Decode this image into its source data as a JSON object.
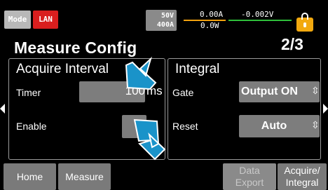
{
  "status_bar": {
    "mode_label": "Mode",
    "lan_label": "LAN",
    "voltage_range": "50V",
    "current_range": "400A",
    "current_reading": "0.00A",
    "voltage_reading": "-0.002V",
    "power_reading": "0.0W",
    "colors": {
      "current_underline": "#f2a20f",
      "voltage_underline": "#2fbf3a"
    }
  },
  "header": {
    "title": "Measure Config",
    "page_indicator": "2/3"
  },
  "acquire_panel": {
    "title": "Acquire Interval",
    "timer_label": "Timer",
    "timer_value": "100",
    "timer_unit": "ms",
    "enable_label": "Enable"
  },
  "integral_panel": {
    "title": "Integral",
    "gate_label": "Gate",
    "gate_value": "Output ON",
    "reset_label": "Reset",
    "reset_value": "Auto"
  },
  "bottom_bar": {
    "home": "Home",
    "measure": "Measure",
    "data_export_line1": "Data",
    "data_export_line2": "Export",
    "acquire_integral_line1": "Acquire/",
    "acquire_integral_line2": "Integral"
  },
  "colors": {
    "lock": "#f2a90f",
    "pointer_arrow": "#1a93c9",
    "lan": "#d91e1e"
  },
  "icons": [
    "lock-icon",
    "pointer-arrow-icon",
    "left-page-arrow-icon",
    "right-page-arrow-icon",
    "up-down-icon"
  ]
}
